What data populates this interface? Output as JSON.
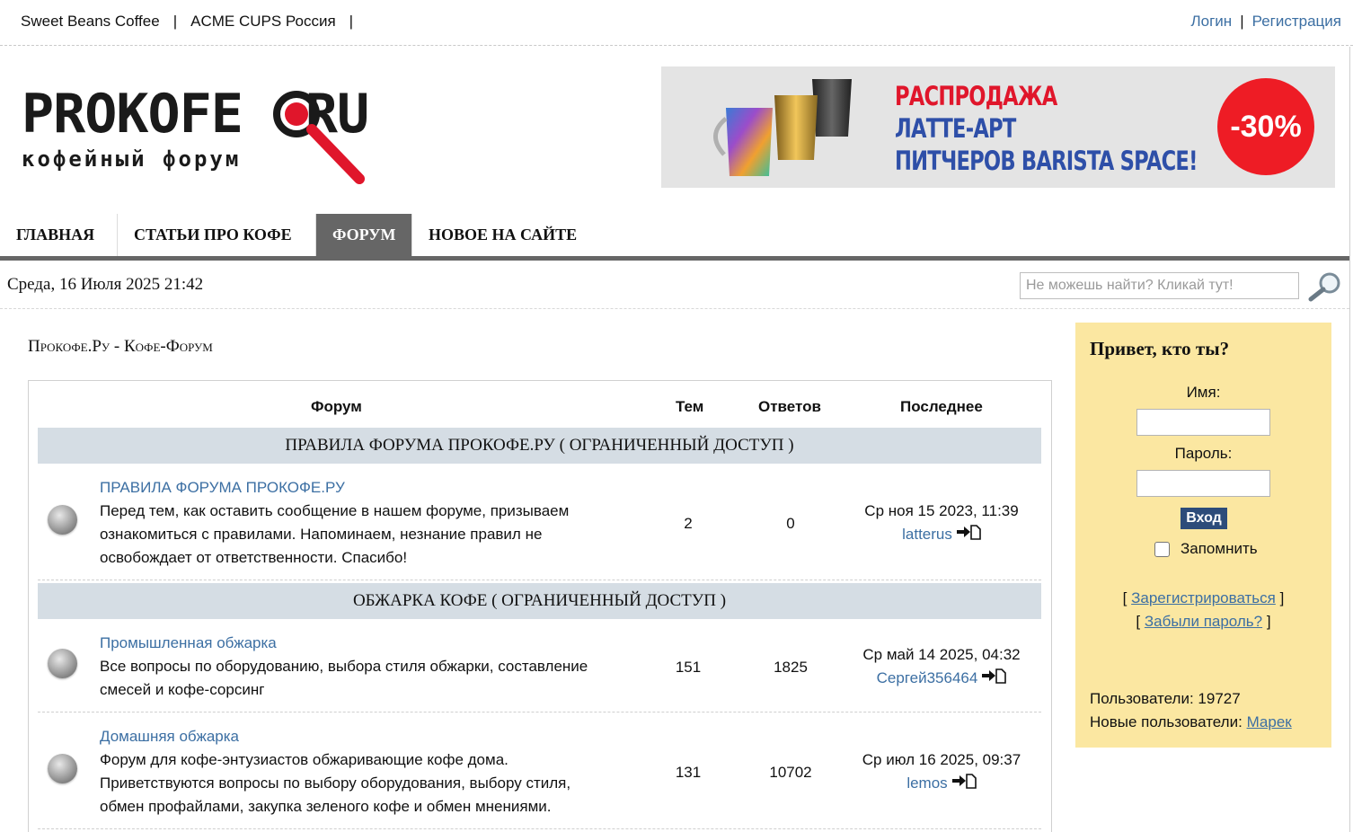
{
  "topbar": {
    "links": [
      "Sweet Beans Coffee",
      "ACME CUPS Россия"
    ],
    "sep": "|",
    "login": "Логин",
    "register": "Регистрация"
  },
  "logo": {
    "word1": "PROKOFE",
    "word2": "RU",
    "subtitle": "кофейный форум"
  },
  "banner": {
    "line1": "РАСПРОДАЖА",
    "line2": "ЛАТТЕ-АРТ",
    "line3": "ПИТЧЕРОВ BARISTA SPACE!",
    "discount": "-30%"
  },
  "nav": {
    "tabs": [
      "ГЛАВНАЯ",
      "СТАТЬИ ПРО КОФЕ",
      "ФОРУМ",
      "НОВОЕ НА САЙТЕ"
    ],
    "active": "ФОРУМ"
  },
  "datetime": "Среда, 16 Июля 2025 21:42",
  "search": {
    "placeholder": "Не можешь найти? Кликай тут!"
  },
  "breadcrumb": "Прокофе.Ру - Кофе-Форум",
  "table": {
    "headers": {
      "forum": "Форум",
      "topics": "Тем",
      "replies": "Ответов",
      "last": "Последнее"
    },
    "categories": [
      "ПРАВИЛА ФОРУМА ПРОКОФЕ.РУ ( ОГРАНИЧЕННЫЙ ДОСТУП )",
      "ОБЖАРКА КОФЕ ( ОГРАНИЧЕННЫЙ ДОСТУП )"
    ],
    "forums": [
      {
        "title": "ПРАВИЛА ФОРУМА ПРОКОФЕ.РУ",
        "desc": "Перед тем, как оставить сообщение в нашем форуме, призываем ознакомиться с правилами. Напоминаем, незнание правил не освобождает от ответственности. Спасибо!",
        "topics": "2",
        "replies": "0",
        "last_date": "Ср ноя 15 2023, 11:39",
        "last_user": "latterus"
      },
      {
        "title": "Промышленная обжарка",
        "desc": "Все вопросы по оборудованию, выбора стиля обжарки, составление смесей и кофе-сорсинг",
        "topics": "151",
        "replies": "1825",
        "last_date": "Ср май 14 2025, 04:32",
        "last_user": "Сергей356464"
      },
      {
        "title": "Домашняя обжарка",
        "desc": "Форум для кофе-энтузиастов обжаривающие кофе дома. Приветствуются вопросы по выбору оборудования, выбору стиля, обмен профайлами, закупка зеленого кофе и обмен мнениями.",
        "topics": "131",
        "replies": "10702",
        "last_date": "Ср июл 16 2025, 09:37",
        "last_user": "lemos"
      }
    ]
  },
  "login": {
    "title": "Привет, кто ты?",
    "name_label": "Имя:",
    "password_label": "Пароль:",
    "submit": "Вход",
    "remember": "Запомнить",
    "register_link": "Зарегистрироваться",
    "forgot_link": "Забыли пароль?",
    "bracket_open": "[",
    "bracket_close": "]",
    "users_label": "Пользователи:",
    "users_count": "19727",
    "new_users_label": "Новые пользователи:",
    "new_user": "Марек"
  },
  "colors": {
    "link": "#3c6fa3",
    "nav_active": "#666666",
    "category_bg": "#d5dde4",
    "login_bg": "#fbe7a1",
    "login_button": "#2d4c7a",
    "banner_red": "#ee1c25",
    "banner_blue": "#2e4fa8"
  }
}
